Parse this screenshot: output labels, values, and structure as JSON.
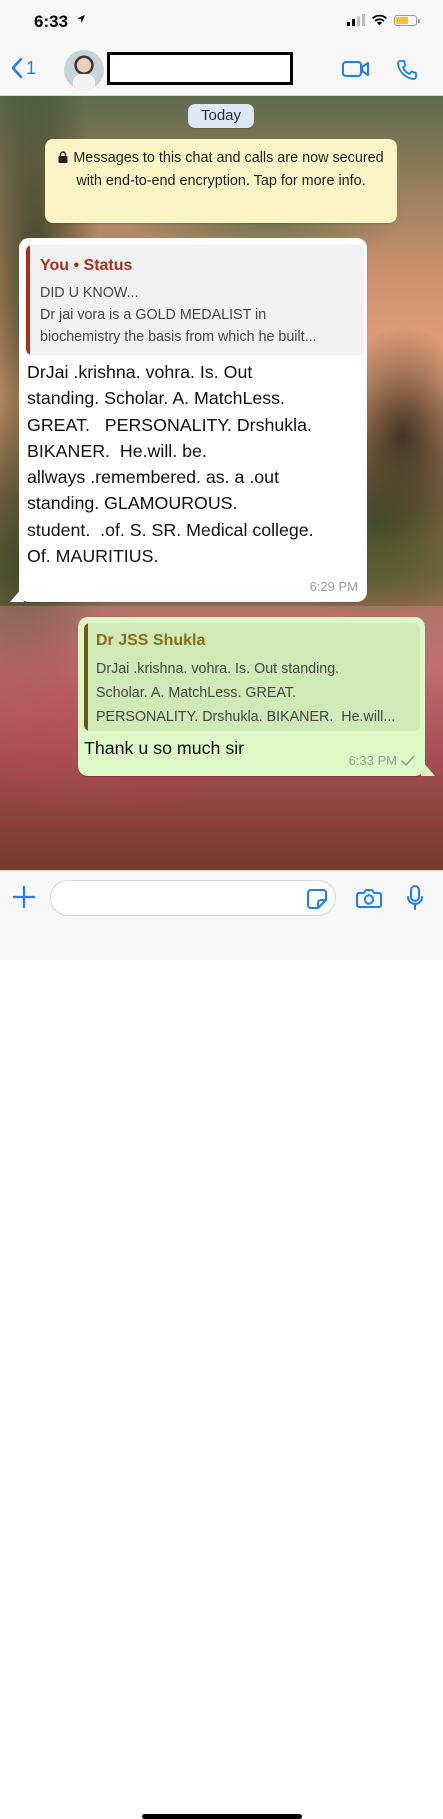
{
  "status_bar": {
    "time": "6:33"
  },
  "header": {
    "back_count": "1",
    "contact_name": ""
  },
  "date_chip": "Today",
  "encryption_notice": "Messages to this chat and calls are now secured with end-to-end encryption. Tap for more info.",
  "incoming": {
    "quote_title": "You • Status",
    "quote_lines": [
      "DID U KNOW...",
      "Dr jai vora is a GOLD MEDALIST in",
      "biochemistry the basis from which he built..."
    ],
    "lines": [
      "DrJai .krishna. vohra. Is. Out",
      "standing. Scholar. A. MatchLess.",
      "GREAT.   PERSONALITY. Drshukla.",
      "BIKANER.  He.will. be.",
      "allways .remembered. as. a .out",
      "standing. GLAMOUROUS.",
      "student.  .of. S. SR. Medical college.",
      "Of. MAURITIUS."
    ],
    "time": "6:29 PM"
  },
  "outgoing": {
    "quote_title": "Dr JSS Shukla",
    "quote_lines": [
      "DrJai .krishna. vohra. Is. Out standing.",
      "Scholar. A. MatchLess. GREAT.",
      "PERSONALITY. Drshukla. BIKANER.  He.will..."
    ],
    "text": "Thank u so much sir",
    "time": "6:33 PM"
  },
  "input": {
    "placeholder": ""
  },
  "colors": {
    "accent_blue": "#1f7ef3",
    "status_quote_red": "#a9301c",
    "reply_quote_gold": "#8a6d12",
    "outgoing_bubble": "#dcf8c6",
    "notice_yellow": "#fdf4c5",
    "battery_yellow": "#f4c430"
  },
  "icons": {
    "back": "chevron-left-icon",
    "video": "video-camera-icon",
    "call": "phone-icon",
    "attach": "plus-icon",
    "sticker": "sticker-icon",
    "camera": "camera-icon",
    "mic": "microphone-icon"
  }
}
